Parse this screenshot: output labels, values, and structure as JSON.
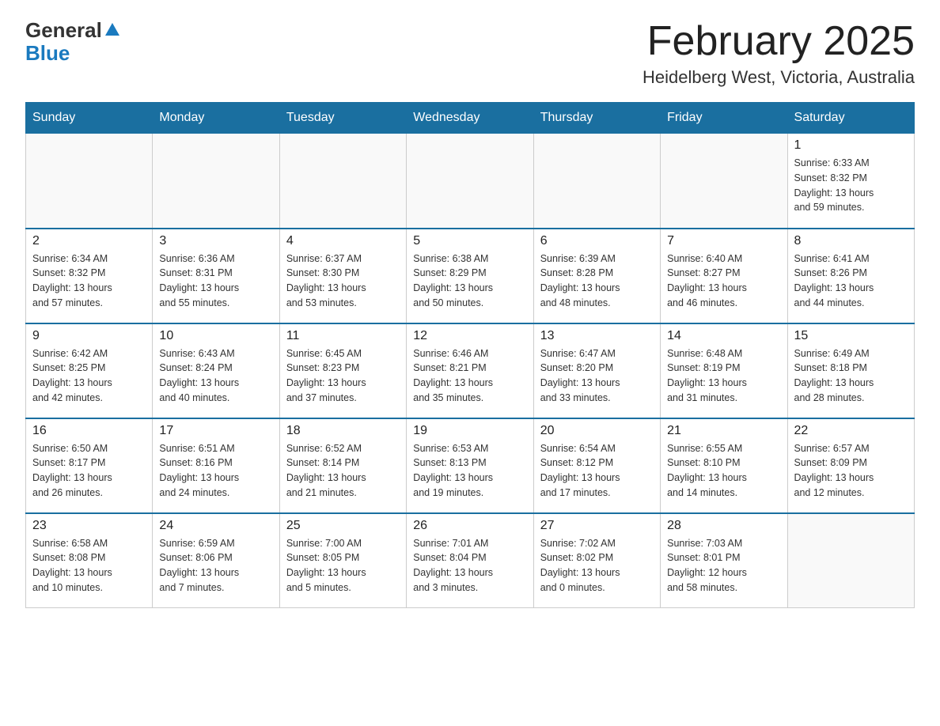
{
  "logo": {
    "text_general": "General",
    "text_blue": "Blue",
    "arrow_symbol": "▲"
  },
  "title": "February 2025",
  "subtitle": "Heidelberg West, Victoria, Australia",
  "days_of_week": [
    "Sunday",
    "Monday",
    "Tuesday",
    "Wednesday",
    "Thursday",
    "Friday",
    "Saturday"
  ],
  "weeks": [
    [
      {
        "day": "",
        "info": ""
      },
      {
        "day": "",
        "info": ""
      },
      {
        "day": "",
        "info": ""
      },
      {
        "day": "",
        "info": ""
      },
      {
        "day": "",
        "info": ""
      },
      {
        "day": "",
        "info": ""
      },
      {
        "day": "1",
        "info": "Sunrise: 6:33 AM\nSunset: 8:32 PM\nDaylight: 13 hours\nand 59 minutes."
      }
    ],
    [
      {
        "day": "2",
        "info": "Sunrise: 6:34 AM\nSunset: 8:32 PM\nDaylight: 13 hours\nand 57 minutes."
      },
      {
        "day": "3",
        "info": "Sunrise: 6:36 AM\nSunset: 8:31 PM\nDaylight: 13 hours\nand 55 minutes."
      },
      {
        "day": "4",
        "info": "Sunrise: 6:37 AM\nSunset: 8:30 PM\nDaylight: 13 hours\nand 53 minutes."
      },
      {
        "day": "5",
        "info": "Sunrise: 6:38 AM\nSunset: 8:29 PM\nDaylight: 13 hours\nand 50 minutes."
      },
      {
        "day": "6",
        "info": "Sunrise: 6:39 AM\nSunset: 8:28 PM\nDaylight: 13 hours\nand 48 minutes."
      },
      {
        "day": "7",
        "info": "Sunrise: 6:40 AM\nSunset: 8:27 PM\nDaylight: 13 hours\nand 46 minutes."
      },
      {
        "day": "8",
        "info": "Sunrise: 6:41 AM\nSunset: 8:26 PM\nDaylight: 13 hours\nand 44 minutes."
      }
    ],
    [
      {
        "day": "9",
        "info": "Sunrise: 6:42 AM\nSunset: 8:25 PM\nDaylight: 13 hours\nand 42 minutes."
      },
      {
        "day": "10",
        "info": "Sunrise: 6:43 AM\nSunset: 8:24 PM\nDaylight: 13 hours\nand 40 minutes."
      },
      {
        "day": "11",
        "info": "Sunrise: 6:45 AM\nSunset: 8:23 PM\nDaylight: 13 hours\nand 37 minutes."
      },
      {
        "day": "12",
        "info": "Sunrise: 6:46 AM\nSunset: 8:21 PM\nDaylight: 13 hours\nand 35 minutes."
      },
      {
        "day": "13",
        "info": "Sunrise: 6:47 AM\nSunset: 8:20 PM\nDaylight: 13 hours\nand 33 minutes."
      },
      {
        "day": "14",
        "info": "Sunrise: 6:48 AM\nSunset: 8:19 PM\nDaylight: 13 hours\nand 31 minutes."
      },
      {
        "day": "15",
        "info": "Sunrise: 6:49 AM\nSunset: 8:18 PM\nDaylight: 13 hours\nand 28 minutes."
      }
    ],
    [
      {
        "day": "16",
        "info": "Sunrise: 6:50 AM\nSunset: 8:17 PM\nDaylight: 13 hours\nand 26 minutes."
      },
      {
        "day": "17",
        "info": "Sunrise: 6:51 AM\nSunset: 8:16 PM\nDaylight: 13 hours\nand 24 minutes."
      },
      {
        "day": "18",
        "info": "Sunrise: 6:52 AM\nSunset: 8:14 PM\nDaylight: 13 hours\nand 21 minutes."
      },
      {
        "day": "19",
        "info": "Sunrise: 6:53 AM\nSunset: 8:13 PM\nDaylight: 13 hours\nand 19 minutes."
      },
      {
        "day": "20",
        "info": "Sunrise: 6:54 AM\nSunset: 8:12 PM\nDaylight: 13 hours\nand 17 minutes."
      },
      {
        "day": "21",
        "info": "Sunrise: 6:55 AM\nSunset: 8:10 PM\nDaylight: 13 hours\nand 14 minutes."
      },
      {
        "day": "22",
        "info": "Sunrise: 6:57 AM\nSunset: 8:09 PM\nDaylight: 13 hours\nand 12 minutes."
      }
    ],
    [
      {
        "day": "23",
        "info": "Sunrise: 6:58 AM\nSunset: 8:08 PM\nDaylight: 13 hours\nand 10 minutes."
      },
      {
        "day": "24",
        "info": "Sunrise: 6:59 AM\nSunset: 8:06 PM\nDaylight: 13 hours\nand 7 minutes."
      },
      {
        "day": "25",
        "info": "Sunrise: 7:00 AM\nSunset: 8:05 PM\nDaylight: 13 hours\nand 5 minutes."
      },
      {
        "day": "26",
        "info": "Sunrise: 7:01 AM\nSunset: 8:04 PM\nDaylight: 13 hours\nand 3 minutes."
      },
      {
        "day": "27",
        "info": "Sunrise: 7:02 AM\nSunset: 8:02 PM\nDaylight: 13 hours\nand 0 minutes."
      },
      {
        "day": "28",
        "info": "Sunrise: 7:03 AM\nSunset: 8:01 PM\nDaylight: 12 hours\nand 58 minutes."
      },
      {
        "day": "",
        "info": ""
      }
    ]
  ]
}
